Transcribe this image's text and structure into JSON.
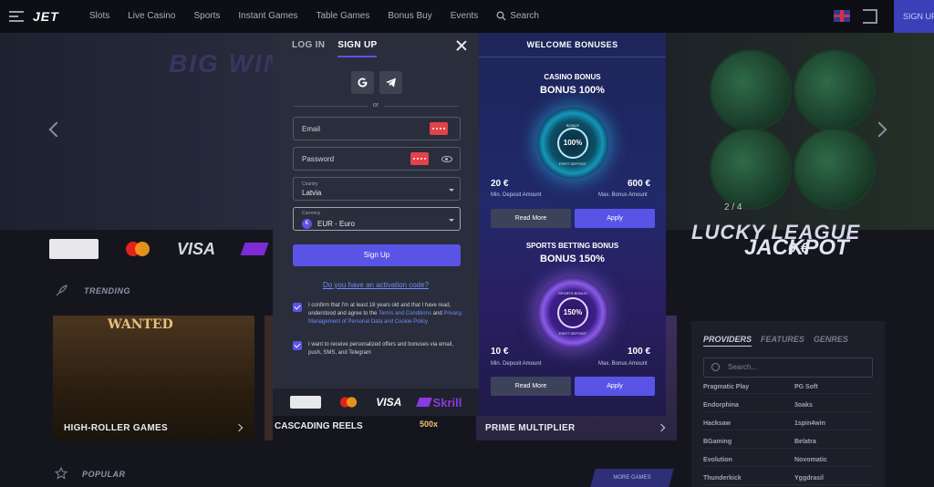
{
  "nav": {
    "logo": "JET",
    "items": [
      "Slots",
      "Live Casino",
      "Sports",
      "Instant Games",
      "Table Games",
      "Bonus Buy",
      "Events"
    ],
    "search": "Search",
    "signup": "SIGN UP"
  },
  "hero": {
    "left_title": "BIG WIN",
    "counter": "2 / 4",
    "title": "LUCKY LEAGUE",
    "subtitle": "JACKPOT",
    "jackpot_value": "0 €"
  },
  "payments": {
    "visa": "VISA"
  },
  "sections": {
    "trending": "TRENDING",
    "popular": "POPULAR",
    "more_games": "MORE GAMES"
  },
  "game_cards": [
    {
      "label": "HIGH-ROLLER GAMES",
      "art_text": "WANTED",
      "color": "#3b2a14"
    },
    {
      "label": "CASCADING REELS",
      "art_text": "500x",
      "color": "#3c2a2a"
    },
    {
      "label": "PRIME MULTIPLIER",
      "art_text": "",
      "color": "#2a2540"
    }
  ],
  "providers": {
    "tabs": [
      "PROVIDERS",
      "FEATURES",
      "GENRES"
    ],
    "search_placeholder": "Search...",
    "items": [
      "Pragmatic Play",
      "PG Soft",
      "Endorphina",
      "3oaks",
      "Hacksaw",
      "1spin4win",
      "BGaming",
      "Belatra",
      "Evolution",
      "Novomatic",
      "Thunderkick",
      "Yggdrasil"
    ]
  },
  "modal": {
    "tab_login": "LOG IN",
    "tab_signup": "SIGN UP",
    "or": "or",
    "email_placeholder": "Email",
    "password_placeholder": "Password",
    "country_label": "Country",
    "country_value": "Latvia",
    "currency_label": "Currency",
    "currency_value": "EUR - Euro",
    "currency_symbol": "€",
    "signup_button": "Sign Up",
    "activation_link": "Do you have an activation code?",
    "consent1_a": "I confirm that I'm at least 18 years old and that I have read, understood and agree to the ",
    "consent1_link1": "Terms and Conditions",
    "consent1_b": " and ",
    "consent1_link2": "Privacy, Management of Personal Data and Cookie Policy",
    "consent2": "I want to receive personalized offers and bonuses via email, push, SMS, and Telegram",
    "footer_visa": "VISA",
    "footer_skrill": "Skrill"
  },
  "bonuses": {
    "header": "WELCOME BONUSES",
    "casino": {
      "title": "CASINO BONUS",
      "headline": "BONUS 100%",
      "wheel_text": "100%",
      "wheel_top": "BONUS",
      "wheel_bottom": "FIRST DEPOSIT",
      "min_amount": "20 €",
      "min_label": "Min. Deposit Amount",
      "max_amount": "600 €",
      "max_label": "Max. Bonus Amount",
      "read_more": "Read More",
      "apply": "Apply"
    },
    "sports": {
      "title": "SPORTS BETTING BONUS",
      "headline": "BONUS 150%",
      "wheel_text": "150%",
      "wheel_top": "SPORTS BONUS",
      "wheel_bottom": "FIRST DEPOSIT",
      "min_amount": "10 €",
      "min_label": "Min. Deposit Amount",
      "max_amount": "100 €",
      "max_label": "Max. Bonus Amount",
      "read_more": "Read More",
      "apply": "Apply"
    }
  },
  "colors": {
    "accent": "#5a54e6",
    "link": "#6f8cff",
    "danger": "#e2424a"
  }
}
